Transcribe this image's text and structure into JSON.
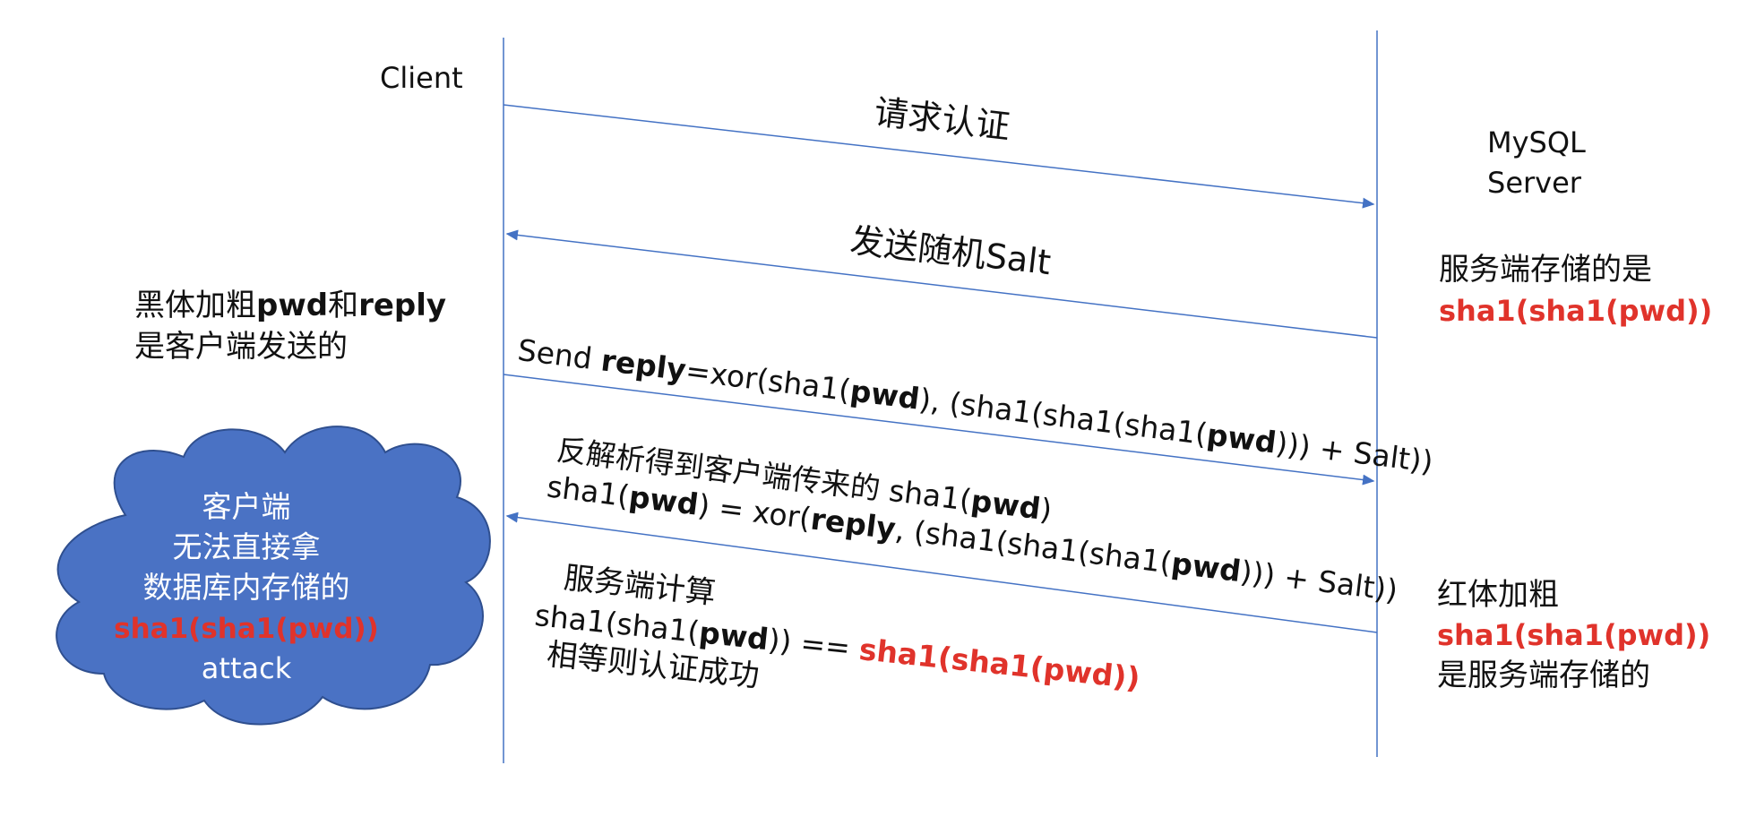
{
  "participants": {
    "client": "Client",
    "server_line1": "MySQL",
    "server_line2": "Server"
  },
  "messages": {
    "request_auth": "请求认证",
    "send_salt": "发送随机Salt",
    "send_reply": {
      "p1": "Send ",
      "p2": "reply",
      "p3": "=xor(sha1(",
      "p4": "pwd",
      "p5": "), (sha1(sha1(sha1(",
      "p6": "pwd",
      "p7": "))) + Salt))"
    },
    "reverse_parse": {
      "line1_a": "反解析得到客户端传来的 sha1(",
      "line1_b": "pwd",
      "line1_c": ")",
      "line2_a": "sha1(",
      "line2_b": "pwd",
      "line2_c": ") = xor(",
      "line2_d": "reply",
      "line2_e": ", (sha1(sha1(sha1(",
      "line2_f": "pwd",
      "line2_g": "))) + Salt))"
    },
    "server_compute": {
      "line1": "服务端计算",
      "line2_a": "sha1(sha1(",
      "line2_b": "pwd",
      "line2_c": ")) == ",
      "line2_d": "sha1(sha1(pwd))",
      "line3": "相等则认证成功"
    }
  },
  "notes": {
    "left": {
      "line1_a": "黑体加粗",
      "line1_b": "pwd",
      "line1_c": "和",
      "line1_d": "reply",
      "line2": "是客户端发送的"
    },
    "server_stores": {
      "line1": "服务端存储的是",
      "line2": "sha1(sha1(pwd))"
    },
    "red_bold": {
      "line1": "红体加粗",
      "line2": "sha1(sha1(pwd))",
      "line3": "是服务端存储的"
    }
  },
  "cloud": {
    "line1": "客户端",
    "line2": "无法直接拿",
    "line3": "数据库内存储的",
    "line4": "sha1(sha1(pwd))",
    "line5": "attack"
  },
  "colors": {
    "line": "#4472c4",
    "cloud_fill": "#4a72c4",
    "cloud_stroke": "#2f4f8f",
    "highlight_red": "#e0332b"
  }
}
